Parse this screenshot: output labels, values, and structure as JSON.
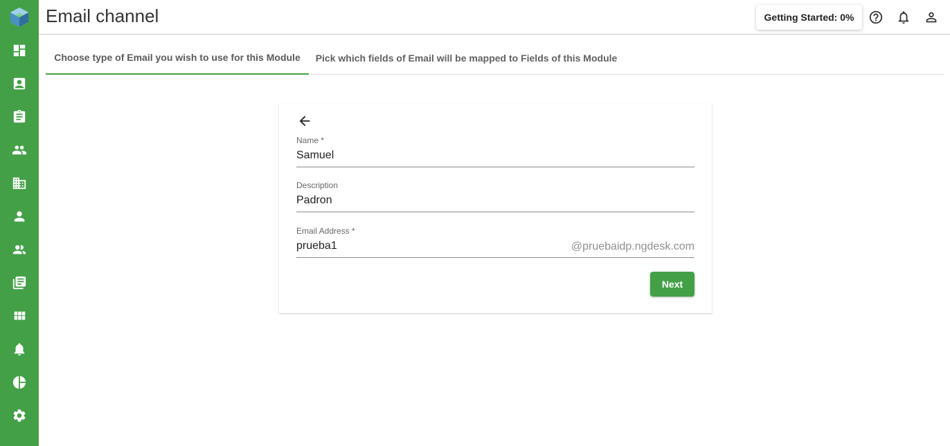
{
  "app": {
    "page_title": "Email channel",
    "brand_color": "#43a047"
  },
  "sidebar": {
    "logo": "cube-logo",
    "items": [
      {
        "icon": "dashboard-icon"
      },
      {
        "icon": "contact-card-icon"
      },
      {
        "icon": "clipboard-icon"
      },
      {
        "icon": "people-icon"
      },
      {
        "icon": "building-icon"
      },
      {
        "icon": "person-icon"
      },
      {
        "icon": "groups-icon"
      },
      {
        "icon": "library-icon"
      },
      {
        "icon": "apps-grid-icon"
      },
      {
        "icon": "bell-icon"
      },
      {
        "icon": "pie-chart-icon"
      },
      {
        "icon": "settings-gear-icon"
      }
    ]
  },
  "header": {
    "getting_started_label": "Getting Started: 0%",
    "icons": [
      "help-icon",
      "notifications-icon",
      "account-icon"
    ]
  },
  "tabs": [
    {
      "label": "Choose type of Email you wish to use for this Module",
      "active": true
    },
    {
      "label": "Pick which fields of Email will be mapped to Fields of this Module",
      "active": false
    }
  ],
  "form": {
    "name_label": "Name *",
    "name_value": "Samuel",
    "description_label": "Description",
    "description_value": "Padron",
    "email_label": "Email Address *",
    "email_value": "prueba1",
    "email_suffix": "@pruebaidp.ngdesk.com",
    "next_label": "Next"
  }
}
